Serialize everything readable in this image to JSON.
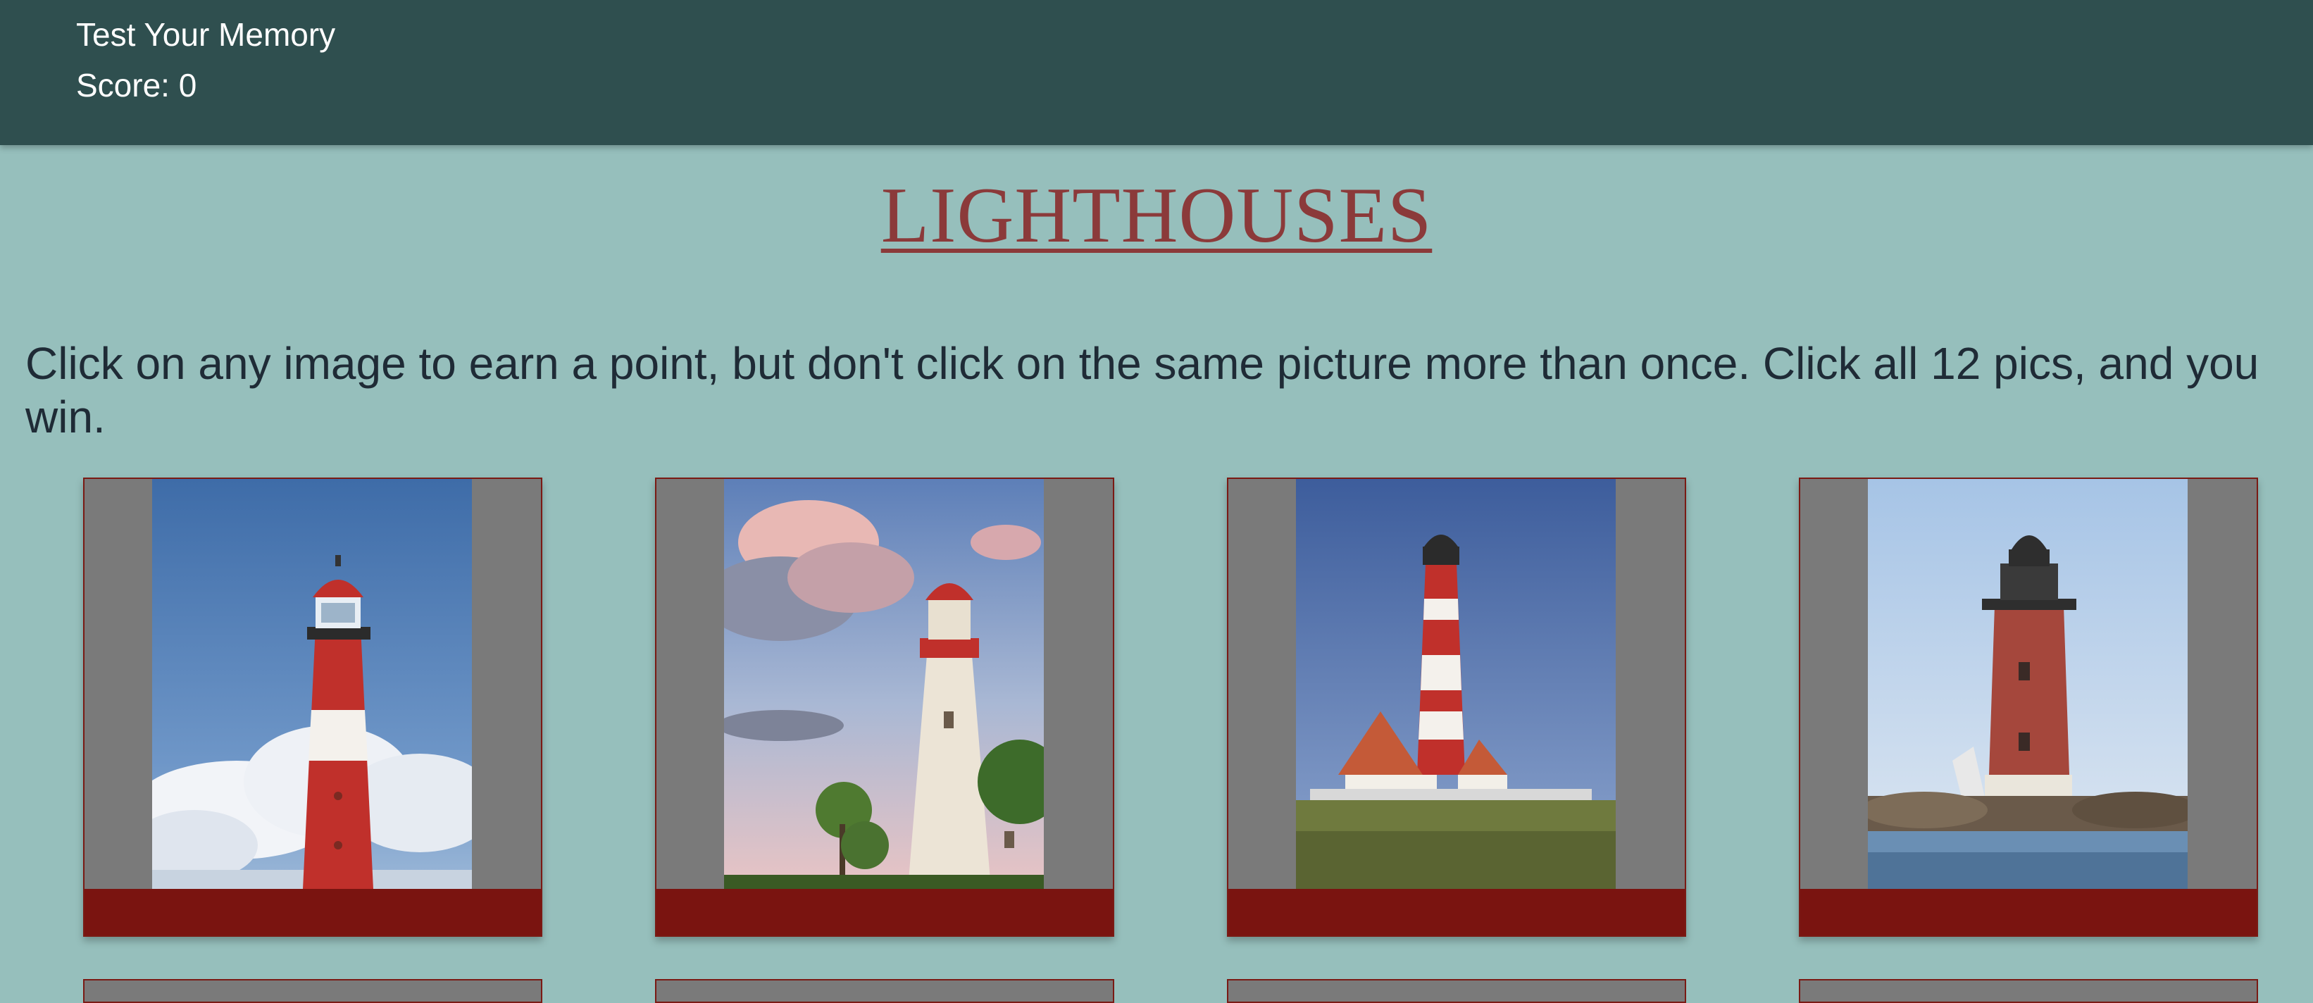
{
  "navbar": {
    "title": "Test Your Memory",
    "score": "Score: 0",
    "background": "#2f4f4f"
  },
  "heading": "LIGHTHOUSES",
  "instructions": "Click on any image to earn a point, but don't click on the same picture more than once. Click all 12 pics, and you win.",
  "colors": {
    "page_background": "#96bfbc",
    "heading": "#8b3a3a",
    "card_footer": "#7a1410",
    "card_frame": "#7a7a7a"
  },
  "cards": [
    {
      "image": "red-white-lighthouse-with-clouds"
    },
    {
      "image": "white-lighthouse-with-pink-clouds"
    },
    {
      "image": "striped-lighthouse-with-red-roof-house"
    },
    {
      "image": "red-brick-lighthouse-on-rocks"
    }
  ]
}
